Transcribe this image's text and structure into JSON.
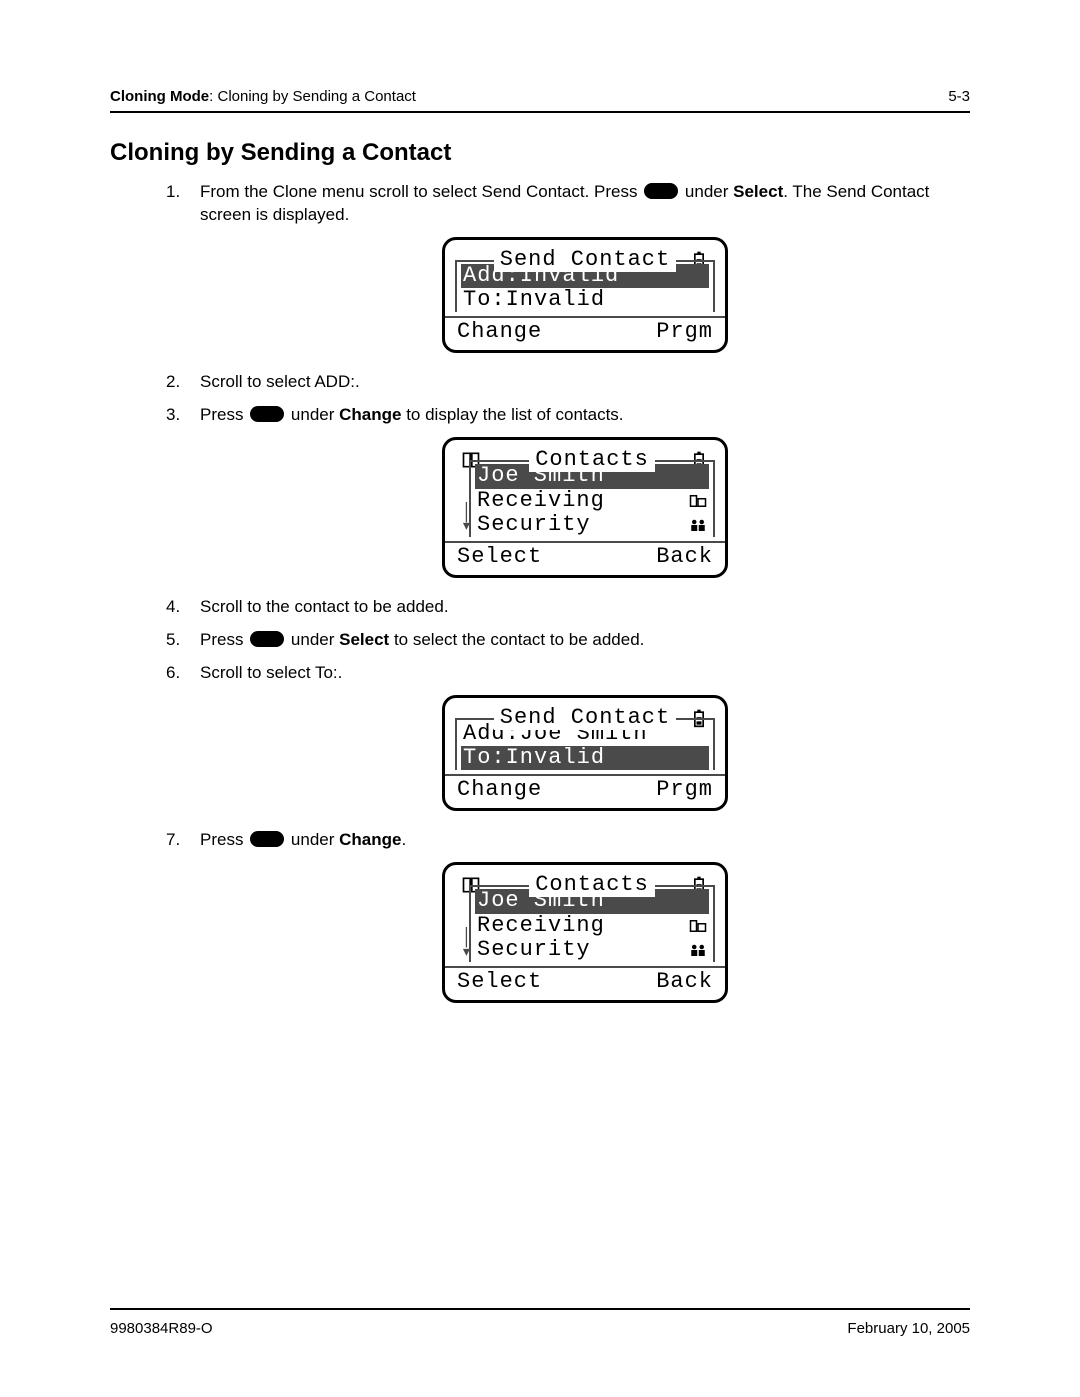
{
  "header": {
    "section_bold": "Cloning Mode",
    "section_rest": ": Cloning by Sending a Contact",
    "page_num": "5-3"
  },
  "title": "Cloning by Sending a Contact",
  "steps": {
    "s1a": "From the Clone menu scroll to select Send Contact. Press ",
    "s1b": " under ",
    "s1_bold": "Select",
    "s1c": ". The Send Contact screen is displayed.",
    "s2": "Scroll to select ADD:.",
    "s3a": "Press ",
    "s3b": " under ",
    "s3_bold": "Change",
    "s3c": " to display the list of contacts.",
    "s4": "Scroll to the contact to be added.",
    "s5a": "Press ",
    "s5b": " under ",
    "s5_bold": "Select",
    "s5c": " to select the contact to be added.",
    "s6": "Scroll to select To:.",
    "s7a": "Press ",
    "s7b": " under ",
    "s7_bold": "Change",
    "s7c": "."
  },
  "lcd1": {
    "title": "Send Contact",
    "row1": "Add:Invalid",
    "row2": "To:Invalid",
    "left": "Change",
    "right": "Prgm"
  },
  "lcd2": {
    "title": "Contacts",
    "row1": "Joe Smith",
    "row2": "Receiving",
    "row3": "Security",
    "left": "Select",
    "right": "Back"
  },
  "lcd3": {
    "title": "Send Contact",
    "row1": "Add:Joe Smith",
    "row2": "To:Invalid",
    "left": "Change",
    "right": "Prgm"
  },
  "lcd4": {
    "title": "Contacts",
    "row1": "Joe Smith",
    "row2": "Receiving",
    "row3": "Security",
    "left": "Select",
    "right": "Back"
  },
  "footer": {
    "doc_id": "9980384R89-O",
    "date": "February 10, 2005"
  }
}
